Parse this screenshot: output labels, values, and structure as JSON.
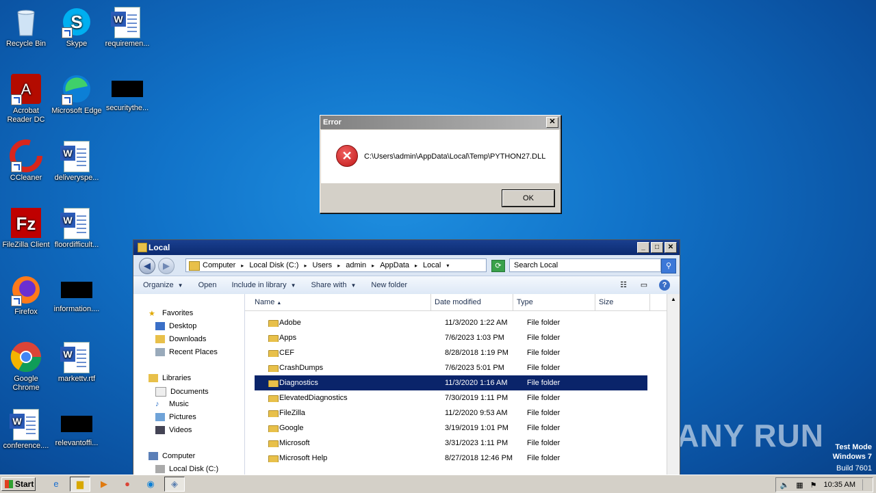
{
  "desktop": {
    "icons": [
      {
        "label": "Recycle Bin",
        "icon": "recycle-bin-icon"
      },
      {
        "label": "Skype",
        "icon": "skype-icon"
      },
      {
        "label": "requiremen...",
        "icon": "word-document-icon"
      },
      {
        "label": "Acrobat Reader DC",
        "icon": "acrobat-icon"
      },
      {
        "label": "Microsoft Edge",
        "icon": "edge-icon"
      },
      {
        "label": "securitythe...",
        "icon": "black-image-icon"
      },
      {
        "label": "CCleaner",
        "icon": "ccleaner-icon"
      },
      {
        "label": "deliveryspe...",
        "icon": "word-document-icon"
      },
      {
        "label": "FileZilla Client",
        "icon": "filezilla-icon"
      },
      {
        "label": "floordifficult...",
        "icon": "word-document-icon"
      },
      {
        "label": "Firefox",
        "icon": "firefox-icon"
      },
      {
        "label": "information....",
        "icon": "black-image-icon"
      },
      {
        "label": "Google Chrome",
        "icon": "chrome-icon"
      },
      {
        "label": "markettv.rtf",
        "icon": "word-document-icon"
      },
      {
        "label": "conference....",
        "icon": "word-document-icon"
      },
      {
        "label": "relevantoffi...",
        "icon": "black-image-icon"
      }
    ],
    "watermark": "ANY RUN",
    "test_mode": [
      "Test Mode",
      "Windows 7",
      "Build 7601"
    ]
  },
  "error_dialog": {
    "title": "Error",
    "close": "✕",
    "message": "C:\\Users\\admin\\AppData\\Local\\Temp\\PYTHON27.DLL",
    "ok_label": "OK"
  },
  "explorer": {
    "title": "Local",
    "breadcrumbs": [
      "Computer",
      "Local Disk (C:)",
      "Users",
      "admin",
      "AppData",
      "Local"
    ],
    "search_placeholder": "Search Local",
    "toolbar": {
      "organize": "Organize",
      "open": "Open",
      "include": "Include in library",
      "share": "Share with",
      "new_folder": "New folder"
    },
    "nav": {
      "favorites": "Favorites",
      "desktop": "Desktop",
      "downloads": "Downloads",
      "recent": "Recent Places",
      "libraries": "Libraries",
      "documents": "Documents",
      "music": "Music",
      "pictures": "Pictures",
      "videos": "Videos",
      "computer": "Computer",
      "local_disk": "Local Disk (C:)"
    },
    "columns": {
      "name": "Name",
      "date": "Date modified",
      "type": "Type",
      "size": "Size"
    },
    "rows": [
      {
        "name": "Adobe",
        "date": "11/3/2020 1:22 AM",
        "type": "File folder"
      },
      {
        "name": "Apps",
        "date": "7/6/2023 1:03 PM",
        "type": "File folder"
      },
      {
        "name": "CEF",
        "date": "8/28/2018 1:19 PM",
        "type": "File folder"
      },
      {
        "name": "CrashDumps",
        "date": "7/6/2023 5:01 PM",
        "type": "File folder"
      },
      {
        "name": "Diagnostics",
        "date": "11/3/2020 1:16 AM",
        "type": "File folder"
      },
      {
        "name": "ElevatedDiagnostics",
        "date": "7/30/2019 1:11 PM",
        "type": "File folder"
      },
      {
        "name": "FileZilla",
        "date": "11/2/2020 9:53 AM",
        "type": "File folder"
      },
      {
        "name": "Google",
        "date": "3/19/2019 1:01 PM",
        "type": "File folder"
      },
      {
        "name": "Microsoft",
        "date": "3/31/2023 1:11 PM",
        "type": "File folder"
      },
      {
        "name": "Microsoft Help",
        "date": "8/27/2018 12:46 PM",
        "type": "File folder"
      }
    ],
    "selected_row": "Diagnostics"
  },
  "taskbar": {
    "start_label": "Start",
    "clock": "10:35 AM"
  }
}
